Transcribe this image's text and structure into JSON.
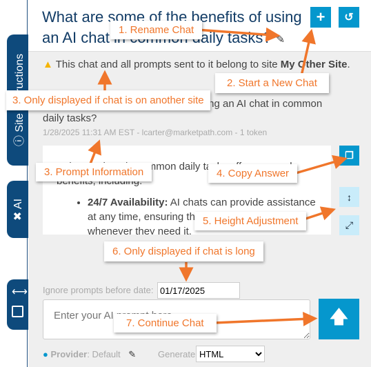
{
  "side_tabs": {
    "site_instructions": "Site Instructions",
    "ai": "AI"
  },
  "header": {
    "title": "What are some of the benefits of using an AI chat in common daily tasks?"
  },
  "warning": {
    "text": "This chat and all prompts sent to it belong to site ",
    "site": "My Other Site",
    "end": "."
  },
  "prompt": {
    "text": "What are some of the benefits of using an AI chat in common daily tasks?",
    "meta": "1/28/2025 11:31 AM EST - lcarter@marketpath.com - 1 token"
  },
  "answer": {
    "intro": "Using AI chats in common daily tasks offers several benefits, including:",
    "bullet_title": "24/7 Availability:",
    "bullet_text": " AI chats can provide assistance at any time, ensuring that users can get help whenever they need it."
  },
  "ignore": {
    "label": "Ignore prompts before date:",
    "value": "01/17/2025"
  },
  "input": {
    "placeholder": "Enter your AI prompt here..."
  },
  "footer": {
    "provider_label": "Provider",
    "provider_value": ": Default",
    "generate_label": "Generate",
    "generate_value": "HTML"
  },
  "annotations": {
    "a1": "1. Rename Chat",
    "a2": "2. Start a New Chat",
    "a3": "3. Only displayed if chat is on another site",
    "a3b": "3. Prompt Information",
    "a4": "4. Copy Answer",
    "a5": "5. Height Adjustment",
    "a6": "6. Only displayed if chat is long",
    "a7": "7. Continue Chat"
  },
  "colors": {
    "accent": "#0597cd",
    "nav": "#0e4a7c",
    "annotation": "#f0762b"
  }
}
